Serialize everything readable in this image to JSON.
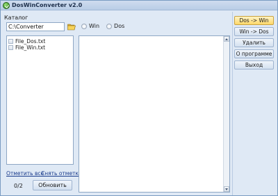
{
  "window": {
    "title": "DosWinConverter v2.0"
  },
  "left": {
    "catalog_label": "Каталог",
    "path_value": "C:\\Converter",
    "files": [
      {
        "name": "File_Dos.txt",
        "checked": false
      },
      {
        "name": "File_Win.txt",
        "checked": false
      }
    ],
    "select_all": "Отметить все",
    "unselect_all": "Снять отметки",
    "counter": "0/2",
    "refresh": "Обновить"
  },
  "encoding": {
    "options": [
      {
        "label": "Win",
        "selected": false
      },
      {
        "label": "Dos",
        "selected": false
      }
    ]
  },
  "text_content": "",
  "actions": [
    {
      "label": "Dos -> Win",
      "active": true
    },
    {
      "label": "Win -> Dos",
      "active": false
    },
    {
      "label": "Удалить",
      "active": false
    },
    {
      "label": "О программе",
      "active": false
    },
    {
      "label": "Выход",
      "active": false
    }
  ]
}
